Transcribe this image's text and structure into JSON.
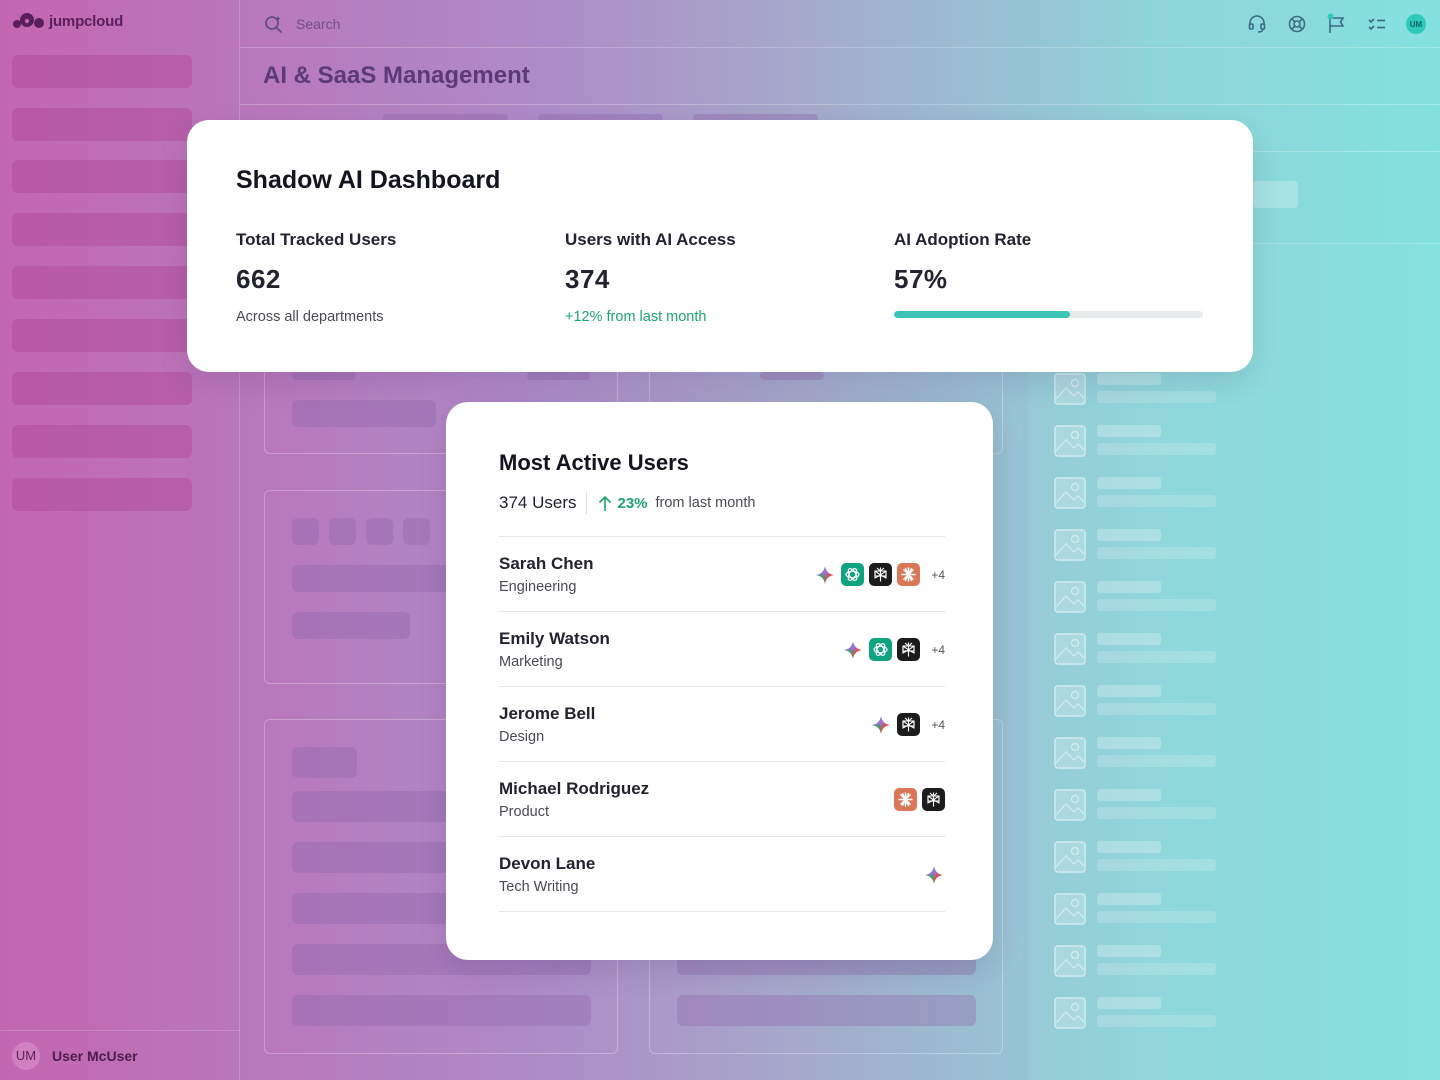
{
  "app": {
    "logo_text": "jumpcloud",
    "search_placeholder": "Search",
    "page_title": "AI & SaaS Management",
    "user_initials": "UM",
    "user_name": "User McUser",
    "accent": "#2fc9b8"
  },
  "dashboard": {
    "title": "Shadow AI Dashboard",
    "stats": [
      {
        "label": "Total Tracked Users",
        "value": "662",
        "sub": "Across all departments"
      },
      {
        "label": "Users with AI Access",
        "value": "374",
        "sub": "+12% from last month"
      },
      {
        "label": "AI Adoption Rate",
        "value": "57%",
        "progress": 57
      }
    ]
  },
  "active_users": {
    "title": "Most Active Users",
    "count": "374 Users",
    "trend_pct": "23%",
    "trend_text": "from last month",
    "users": [
      {
        "name": "Sarah Chen",
        "dept": "Engineering",
        "tools": [
          "gemini-icon",
          "chatgpt-icon",
          "perplexity-icon",
          "claude-icon"
        ],
        "more": "+4"
      },
      {
        "name": "Emily Watson",
        "dept": "Marketing",
        "tools": [
          "gemini-icon",
          "chatgpt-icon",
          "perplexity-icon"
        ],
        "more": "+4"
      },
      {
        "name": "Jerome Bell",
        "dept": "Design",
        "tools": [
          "gemini-icon",
          "perplexity-icon"
        ],
        "more": "+4"
      },
      {
        "name": "Michael Rodriguez",
        "dept": "Product",
        "tools": [
          "claude-icon",
          "perplexity-icon"
        ],
        "more": ""
      },
      {
        "name": "Devon Lane",
        "dept": "Tech Writing",
        "tools": [
          "gemini-icon"
        ],
        "more": ""
      }
    ]
  }
}
